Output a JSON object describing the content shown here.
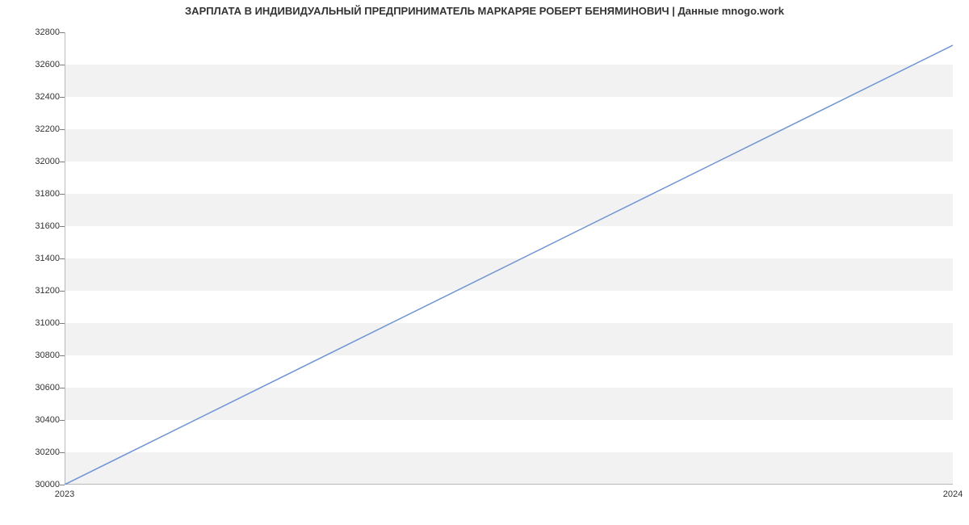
{
  "chart_data": {
    "type": "line",
    "title": "ЗАРПЛАТА В ИНДИВИДУАЛЬНЫЙ ПРЕДПРИНИМАТЕЛЬ МАРКАРЯЕ РОБЕРТ БЕНЯМИНОВИЧ | Данные mnogo.work",
    "x": [
      2023,
      2024
    ],
    "y": [
      30000,
      32720
    ],
    "xlabel": "",
    "ylabel": "",
    "x_ticks": [
      2023,
      2024
    ],
    "y_ticks": [
      30000,
      30200,
      30400,
      30600,
      30800,
      31000,
      31200,
      31400,
      31600,
      31800,
      32000,
      32200,
      32400,
      32600,
      32800
    ],
    "xlim": [
      2023,
      2024
    ],
    "ylim": [
      30000,
      32800
    ],
    "line_color": "#6f94d4",
    "grid_band_color": "#f2f2f2",
    "axis_color": "#808080"
  }
}
